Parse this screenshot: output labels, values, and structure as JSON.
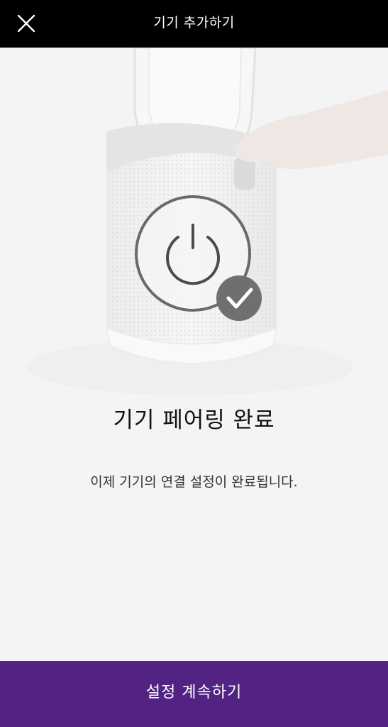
{
  "header": {
    "title": "기기 추가하기"
  },
  "main": {
    "title": "기기 페어링 완료",
    "subtitle": "이제 기기의 연결 설정이 완료됩니다."
  },
  "footer": {
    "continue_label": "설정 계속하기"
  },
  "colors": {
    "header_bg": "#000000",
    "button_bg": "#532384",
    "page_bg": "#f4f4f4"
  }
}
